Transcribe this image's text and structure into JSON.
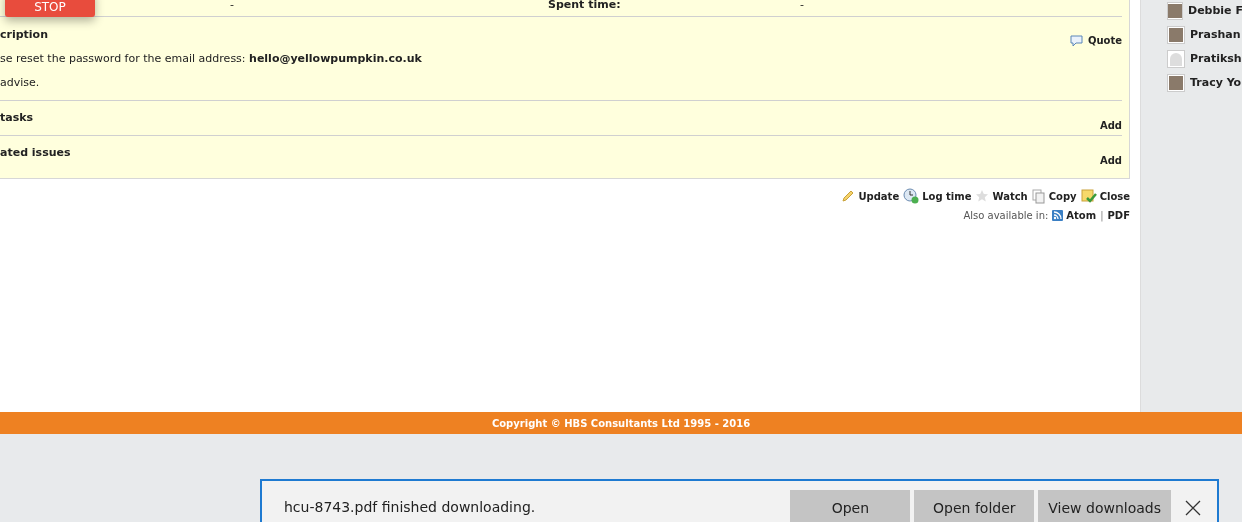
{
  "stop_button": "STOP",
  "attributes": [
    {
      "value": "-"
    },
    {
      "label": "Spent time:",
      "value": "-"
    }
  ],
  "description": {
    "title": "cription",
    "quote": "Quote",
    "lines": [
      "se reset the password for the email address: **hello@yellowpumpkin.co.uk**",
      "advise."
    ]
  },
  "sections": [
    {
      "title": "tasks",
      "action": "Add"
    },
    {
      "title": "ated issues",
      "action": "Add"
    }
  ],
  "actions": [
    {
      "kind": "update",
      "label": "Update"
    },
    {
      "kind": "log",
      "label": "Log time"
    },
    {
      "kind": "watch",
      "label": "Watch"
    },
    {
      "kind": "copy",
      "label": "Copy"
    },
    {
      "kind": "close",
      "label": "Close"
    }
  ],
  "formats": {
    "label": "Also available in:",
    "links": [
      {
        "kind": "feed",
        "label": "Atom"
      },
      {
        "kind": "plain",
        "label": "PDF"
      }
    ],
    "separator": "|"
  },
  "watchers": [
    {
      "name": "Debbie F",
      "kind": "photo"
    },
    {
      "name": "Prashan",
      "kind": "photo"
    },
    {
      "name": "Pratiksh",
      "kind": "blank"
    },
    {
      "name": "Tracy Yo",
      "kind": "photo"
    }
  ],
  "footer": "Copyright © HBS Consultants Ltd 1995 - 2016",
  "download_bar": {
    "message": "hcu-8743.pdf finished downloading.",
    "buttons": [
      "Open",
      "Open folder",
      "View downloads"
    ]
  }
}
